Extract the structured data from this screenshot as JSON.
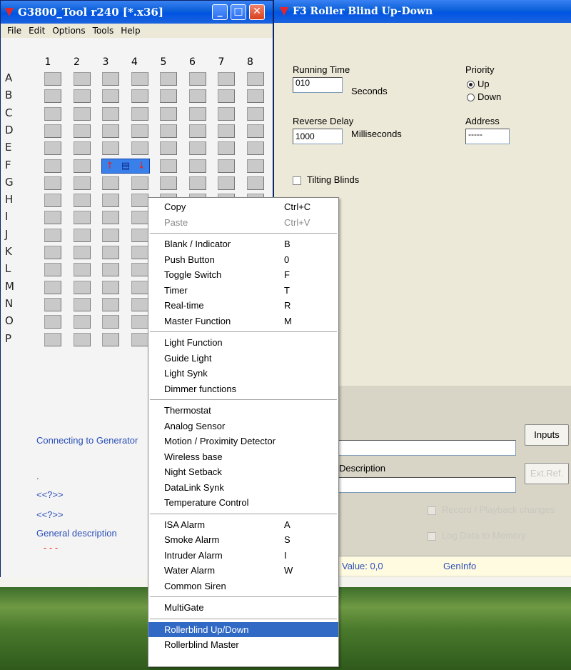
{
  "main_window": {
    "title": "G3800_Tool r240 [*.x36]",
    "menu": [
      "File",
      "Edit",
      "Options",
      "Tools",
      "Help"
    ],
    "columns": [
      "1",
      "2",
      "3",
      "4",
      "5",
      "6",
      "7",
      "8"
    ],
    "rows": [
      "A",
      "B",
      "C",
      "D",
      "E",
      "F",
      "G",
      "H",
      "I",
      "J",
      "K",
      "L",
      "M",
      "N",
      "O",
      "P"
    ],
    "status": {
      "connecting": "Connecting to Generator",
      "dot": ".",
      "q1": "<<?>>",
      "q2": "<<?>>",
      "general": "General description",
      "dashes": "- - -"
    }
  },
  "detail_window": {
    "title": "F3   Roller Blind Up-Down",
    "running_time": {
      "label": "Running Time",
      "value": "010",
      "unit": "Seconds"
    },
    "reverse_delay": {
      "label": "Reverse Delay",
      "value": "1000",
      "unit": "Milliseconds"
    },
    "priority": {
      "label": "Priority",
      "up": "Up",
      "down": "Down",
      "selected": "Up"
    },
    "address": {
      "label": "Address",
      "value": "-----"
    },
    "tilting": "Tilting Blinds",
    "inputs_button": "Inputs",
    "description_label": "Description",
    "extref_button": "Ext.Ref.",
    "record": "Record / Playback changes",
    "log": "Log Data to Memory",
    "value": "Value: 0,0",
    "geninfo": "GenInfo"
  },
  "context_menu": {
    "items": [
      {
        "label": "Copy",
        "key": "Ctrl+C"
      },
      {
        "label": "Paste",
        "key": "Ctrl+V",
        "disabled": true
      },
      {
        "sep": true
      },
      {
        "label": "Blank / Indicator",
        "key": "B"
      },
      {
        "label": "Push Button",
        "key": "0"
      },
      {
        "label": "Toggle Switch",
        "key": "F"
      },
      {
        "label": "Timer",
        "key": "T"
      },
      {
        "label": "Real-time",
        "key": "R"
      },
      {
        "label": "Master Function",
        "key": "M"
      },
      {
        "sep": true
      },
      {
        "label": "Light Function"
      },
      {
        "label": "Guide Light"
      },
      {
        "label": "Light Synk"
      },
      {
        "label": "Dimmer functions"
      },
      {
        "sep": true
      },
      {
        "label": "Thermostat"
      },
      {
        "label": "Analog Sensor"
      },
      {
        "label": "Motion / Proximity Detector"
      },
      {
        "label": "Wireless base"
      },
      {
        "label": "Night Setback"
      },
      {
        "label": "DataLink Synk"
      },
      {
        "label": "Temperature Control"
      },
      {
        "sep": true
      },
      {
        "label": "ISA Alarm",
        "key": "A"
      },
      {
        "label": "Smoke Alarm",
        "key": "S"
      },
      {
        "label": "Intruder Alarm",
        "key": "I"
      },
      {
        "label": "Water Alarm",
        "key": "W"
      },
      {
        "label": "Common Siren"
      },
      {
        "sep": true
      },
      {
        "label": "MultiGate"
      },
      {
        "sep": true
      },
      {
        "label": "Rollerblind Up/Down",
        "highlighted": true
      },
      {
        "label": "Rollerblind Master"
      }
    ]
  }
}
